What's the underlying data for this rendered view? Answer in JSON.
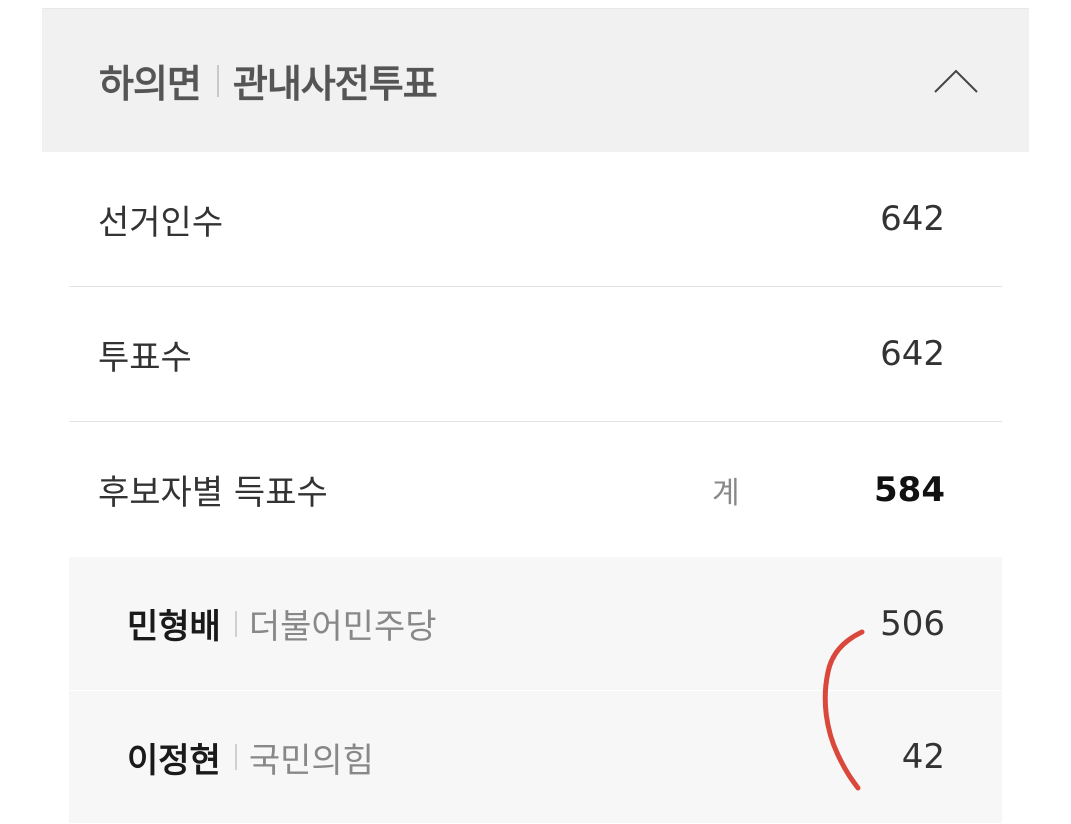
{
  "header": {
    "region": "하의면",
    "station": "관내사전투표"
  },
  "stats": {
    "electorate_label": "선거인수",
    "electorate_value": "642",
    "turnout_label": "투표수",
    "turnout_value": "642",
    "candidate_votes_label": "후보자별 득표수",
    "total_label": "계",
    "total_value": "584"
  },
  "candidates": [
    {
      "name": "민형배",
      "party": "더불어민주당",
      "votes": "506"
    },
    {
      "name": "이정현",
      "party": "국민의힘",
      "votes": "42"
    }
  ],
  "colors": {
    "header_bg": "#f1f1f1",
    "annotation": "#d9483b"
  },
  "icons": {
    "collapse": "chevron-up-icon"
  }
}
